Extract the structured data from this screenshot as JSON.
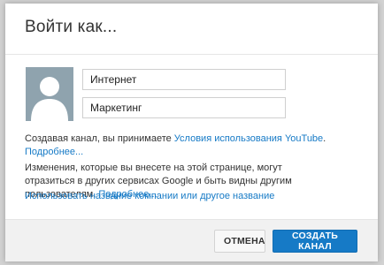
{
  "dialog": {
    "title": "Войти как..."
  },
  "form": {
    "first_name_value": "Интернет",
    "last_name_value": "Маркетинг"
  },
  "notice": {
    "terms_prefix": "Создавая канал, вы принимаете ",
    "terms_link": "Условия использования YouTube",
    "terms_suffix": ".",
    "terms_more": "Подробнее...",
    "changes_text": "Изменения, которые вы внесете на этой странице, могут отразиться в других сервисах Google и быть видны другим пользователям. ",
    "changes_more": "Подробнее...",
    "business_name_link": "Использовать название компании или другое название"
  },
  "footer": {
    "cancel_label": "ОТМЕНА",
    "create_label": "СОЗДАТЬ КАНАЛ"
  },
  "colors": {
    "link": "#167ac6",
    "primary_button": "#167ac6",
    "avatar_bg": "#8fa3ae"
  },
  "icons": {
    "avatar": "default-user-silhouette-icon"
  }
}
